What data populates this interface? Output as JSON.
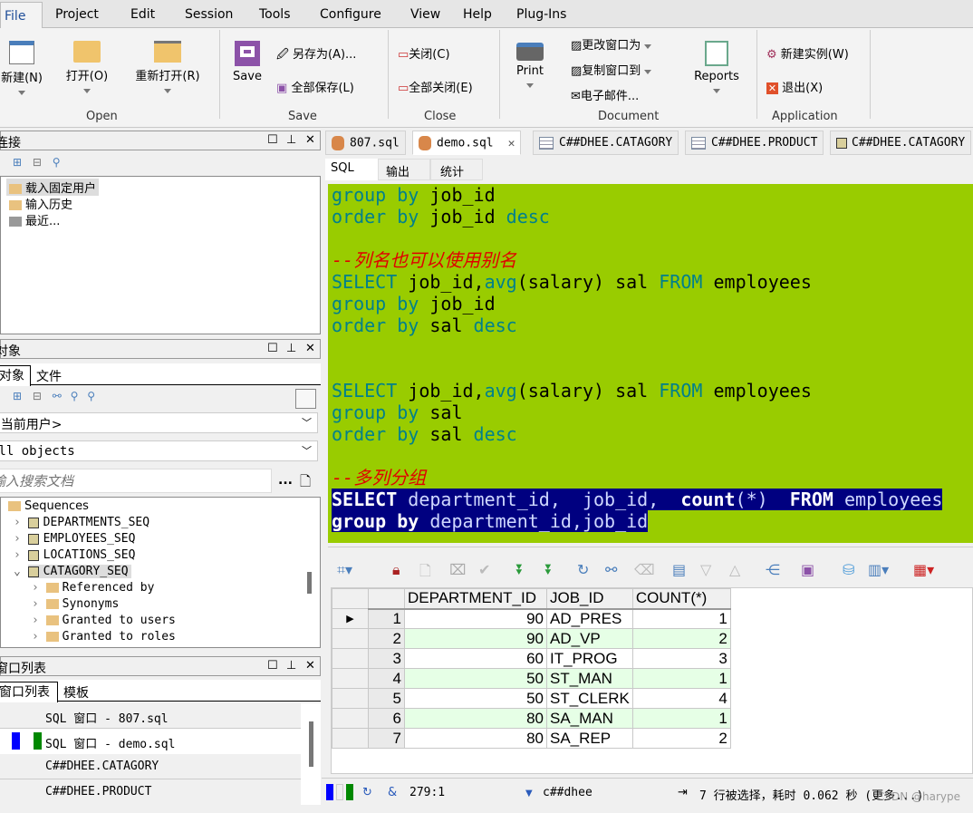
{
  "menu": [
    "File",
    "Project",
    "Edit",
    "Session",
    "Tools",
    "Configure",
    "View",
    "Help",
    "Plug-Ins"
  ],
  "ribbon": {
    "open_group": "Open",
    "new": "新建(N)",
    "open": "打开(O)",
    "reopen": "重新打开(R)",
    "save_group": "Save",
    "save": "Save",
    "save_as": "另存为(A)...",
    "save_all": "全部保存(L)",
    "close_group": "Close",
    "close": "关闭(C)",
    "close_all": "全部关闭(E)",
    "doc_group": "Document",
    "print": "Print",
    "change_window": "更改窗口为",
    "copy_window": "复制窗口到",
    "email": "电子邮件...",
    "reports": "Reports",
    "app_group": "Application",
    "new_instance": "新建实例(W)",
    "exit": "退出(X)"
  },
  "connections": {
    "title": "连接",
    "items": [
      "载入固定用户",
      "输入历史",
      "最近..."
    ]
  },
  "objects": {
    "title": "对象",
    "tabs": [
      "对象",
      "文件"
    ],
    "user": "<当前用户>",
    "filter": "All objects",
    "search_placeholder": "输入搜索文档",
    "more": "...",
    "tree": {
      "folder": "Sequences",
      "seqs": [
        "DEPARTMENTS_SEQ",
        "EMPLOYEES_SEQ",
        "LOCATIONS_SEQ",
        "CATAGORY_SEQ"
      ],
      "children": [
        "Referenced by",
        "Synonyms",
        "Granted to users",
        "Granted to roles"
      ]
    }
  },
  "windows": {
    "title": "窗口列表",
    "tabs": [
      "窗口列表",
      "模板"
    ],
    "items": [
      "SQL 窗口 - 807.sql",
      "SQL 窗口 - demo.sql",
      "C##DHEE.CATAGORY",
      "C##DHEE.PRODUCT"
    ]
  },
  "doc_tabs": [
    "807.sql",
    "demo.sql",
    "C##DHEE.CATAGORY",
    "C##DHEE.PRODUCT",
    "C##DHEE.CATAGORY"
  ],
  "sub_tabs": [
    "SQL",
    "输出",
    "统计"
  ],
  "editor_lines": [
    [
      [
        "kw",
        "group by "
      ],
      [
        "id",
        "job_id"
      ]
    ],
    [
      [
        "kw",
        "order by "
      ],
      [
        "id",
        "job_id "
      ],
      [
        "kw",
        "desc"
      ]
    ],
    [],
    [
      [
        "cm",
        "--列名也可以使用别名"
      ]
    ],
    [
      [
        "kw",
        "SELECT "
      ],
      [
        "id",
        "job_id,"
      ],
      [
        "fn",
        "avg"
      ],
      [
        "id",
        "(salary) sal "
      ],
      [
        "kw",
        "FROM "
      ],
      [
        "id",
        "employees"
      ]
    ],
    [
      [
        "kw",
        "group by "
      ],
      [
        "id",
        "job_id"
      ]
    ],
    [
      [
        "kw",
        "order by "
      ],
      [
        "id",
        "sal "
      ],
      [
        "kw",
        "desc"
      ]
    ],
    [],
    [],
    [
      [
        "kw",
        "SELECT "
      ],
      [
        "id",
        "job_id,"
      ],
      [
        "fn",
        "avg"
      ],
      [
        "id",
        "(salary) sal "
      ],
      [
        "kw",
        "FROM "
      ],
      [
        "id",
        "employees"
      ]
    ],
    [
      [
        "kw",
        "group by "
      ],
      [
        "id",
        "sal"
      ]
    ],
    [
      [
        "kw",
        "order by "
      ],
      [
        "id",
        "sal "
      ],
      [
        "kw",
        "desc"
      ]
    ],
    [],
    [
      [
        "cm",
        "--多列分组"
      ]
    ],
    [
      [
        "kw",
        "SELECT "
      ],
      [
        "id",
        "department_id,  job_id,  "
      ],
      [
        "fn",
        "count"
      ],
      [
        "id",
        "(*)  "
      ],
      [
        "kw",
        "FROM "
      ],
      [
        "id",
        "employees"
      ]
    ],
    [
      [
        "kw",
        "group by "
      ],
      [
        "id",
        "department_id,job_id"
      ]
    ]
  ],
  "selected_lines": [
    14,
    15
  ],
  "results": {
    "columns": [
      "DEPARTMENT_ID",
      "JOB_ID",
      "COUNT(*)"
    ],
    "rows": [
      [
        "1",
        "90",
        "AD_PRES",
        "1"
      ],
      [
        "2",
        "90",
        "AD_VP",
        "2"
      ],
      [
        "3",
        "60",
        "IT_PROG",
        "3"
      ],
      [
        "4",
        "50",
        "ST_MAN",
        "1"
      ],
      [
        "5",
        "50",
        "ST_CLERK",
        "4"
      ],
      [
        "6",
        "80",
        "SA_MAN",
        "1"
      ],
      [
        "7",
        "80",
        "SA_REP",
        "2"
      ]
    ]
  },
  "status": {
    "position": "279:1",
    "user": "c##dhee",
    "message": "7 行被选择，耗时 0.062 秒 (更多...)",
    "watermark": "CSDN @harype"
  },
  "colors": {
    "editor_bg": "#99cc00",
    "keyword": "#00808c",
    "comment": "#e00000",
    "selection": "#000080",
    "alt_row": "#e6ffe6"
  }
}
